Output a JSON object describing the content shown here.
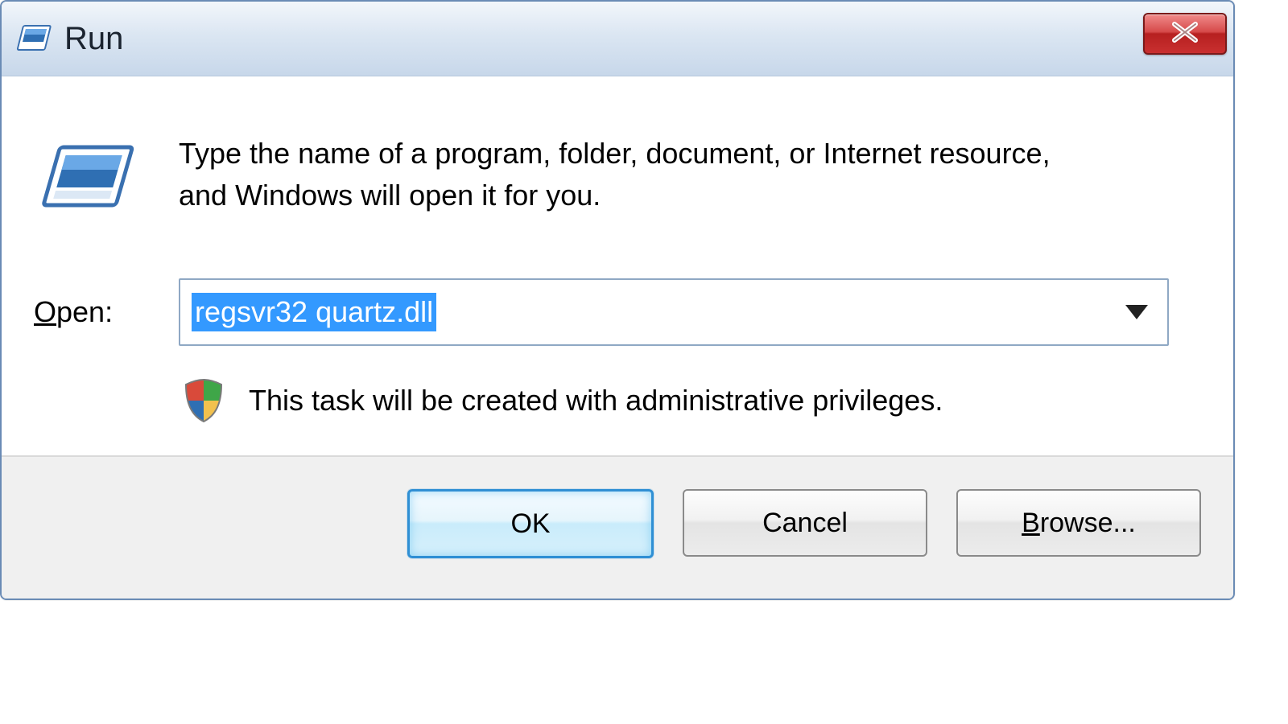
{
  "dialog": {
    "title": "Run",
    "description": "Type the name of a program, folder, document, or Internet resource, and Windows will open it for you.",
    "open_label_prefix": "O",
    "open_label_rest": "pen:",
    "open_value": "regsvr32 quartz.dll",
    "admin_note": "This task will be created with administrative privileges.",
    "buttons": {
      "ok": "OK",
      "cancel": "Cancel",
      "browse_prefix": "B",
      "browse_rest": "rowse..."
    }
  }
}
